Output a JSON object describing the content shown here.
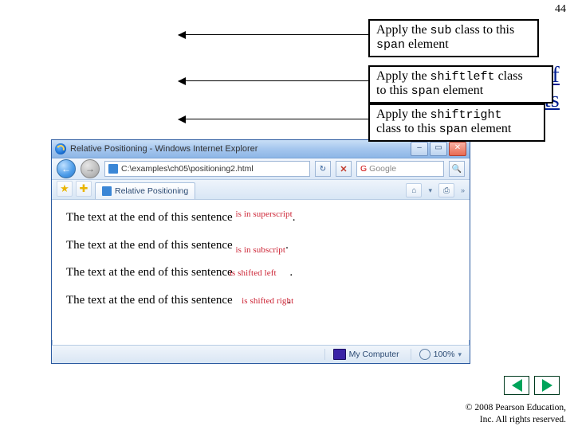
{
  "page_number": "44",
  "heading_fragment": {
    "line1": "g of",
    "line2": "elements"
  },
  "callouts": {
    "c1": {
      "t1": "Apply the ",
      "code1": "sub",
      "t2": " class to this",
      "line2a": "",
      "code2": "span",
      "line2b": " element"
    },
    "c2": {
      "t1": "Apply the ",
      "code1": "shiftleft",
      "t2": " class",
      "line2a": "to this ",
      "code2": "span",
      "line2b": " element"
    },
    "c3": {
      "t1": "Apply the ",
      "code1": "shiftright",
      "t2": "",
      "line2a": "class to this ",
      "code2": "span",
      "line2b": " element"
    }
  },
  "ie": {
    "title": "Relative Positioning - Windows Internet Explorer",
    "address": "C:\\examples\\ch05\\positioning2.html",
    "search_placeholder": "Google",
    "tab": "Relative Positioning",
    "status_zone": "My Computer",
    "status_zoom": "100%",
    "content": {
      "base": "The text at the end of this sentence ",
      "period": ".",
      "s1": "is in superscript",
      "s2": "is in subscript",
      "s3": "is shifted left",
      "s4": "is shifted right"
    }
  },
  "copyright": {
    "line1": "© 2008 Pearson Education,",
    "line2": "Inc.  All rights reserved."
  }
}
